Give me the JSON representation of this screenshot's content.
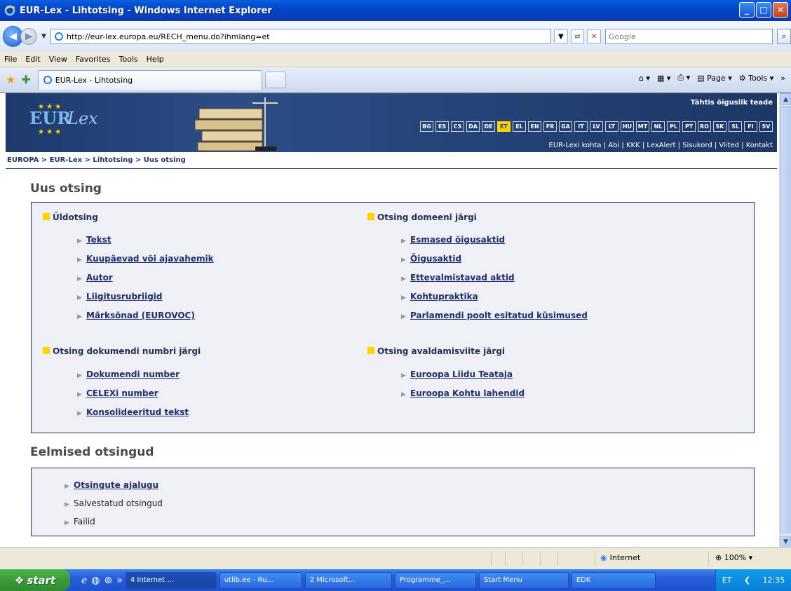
{
  "window": {
    "title": "EUR-Lex - Lihtotsing - Windows Internet Explorer",
    "min": "_",
    "max": "□",
    "close": "✕"
  },
  "address": {
    "url": "http://eur-lex.europa.eu/RECH_menu.do?ihmlang=et",
    "search_placeholder": "Google"
  },
  "menu": [
    "File",
    "Edit",
    "View",
    "Favorites",
    "Tools",
    "Help"
  ],
  "tab": {
    "label": "EUR-Lex - Lihtotsing",
    "page_label": "Page",
    "tools_label": "Tools"
  },
  "site": {
    "important_notice": "Tähtis õiguslik teade",
    "languages": [
      "BG",
      "ES",
      "CS",
      "DA",
      "DE",
      "ET",
      "EL",
      "EN",
      "FR",
      "GA",
      "IT",
      "LV",
      "LT",
      "HU",
      "MT",
      "NL",
      "PL",
      "PT",
      "RO",
      "SK",
      "SL",
      "FI",
      "SV"
    ],
    "selected_language": "ET",
    "top_links": "EUR-Lexi kohta | Abi | KKK | LexAlert | Sisukord | Viited | Kontakt",
    "breadcrumb": "EUROPA > EUR-Lex > Lihtotsing > Uus otsing"
  },
  "main": {
    "heading": "Uus otsing",
    "sections": {
      "general": {
        "title": "Üldotsing",
        "links": [
          "Tekst",
          "Kuupäevad või ajavahemik",
          "Autor",
          "Liigitusrubriigid",
          "Märksõnad (EUROVOC)"
        ]
      },
      "domain": {
        "title": "Otsing domeeni järgi",
        "links": [
          "Esmased õigusaktid",
          "Õigusaktid",
          "Ettevalmistavad aktid",
          "Kohtupraktika",
          "Parlamendi poolt esitatud küsimused"
        ]
      },
      "docnumber": {
        "title": "Otsing dokumendi numbri järgi",
        "links": [
          "Dokumendi number",
          "CELEXi number",
          "Konsolideeritud tekst"
        ]
      },
      "publication": {
        "title": "Otsing avaldamisviite järgi",
        "links": [
          "Euroopa Liidu Teataja",
          "Euroopa Kohtu lahendid"
        ]
      }
    },
    "previous": {
      "heading": "Eelmised otsingud",
      "items": [
        "Otsingute ajalugu",
        "Salvestatud otsingud",
        "Failid"
      ]
    }
  },
  "status": {
    "zone": "Internet",
    "zoom": "100%"
  },
  "taskbar": {
    "start": "start",
    "tasks": [
      "4 Internet ...",
      "utlib.ee - Ru...",
      "2 Microsoft...",
      "Programme_...",
      "Start Menu",
      "EDK"
    ],
    "lang": "ET",
    "clock": "12:35"
  },
  "colors": {
    "header_blue": "#1e3a6d",
    "accent_yellow": "#ffd200",
    "box_bg": "#eef0f6"
  }
}
